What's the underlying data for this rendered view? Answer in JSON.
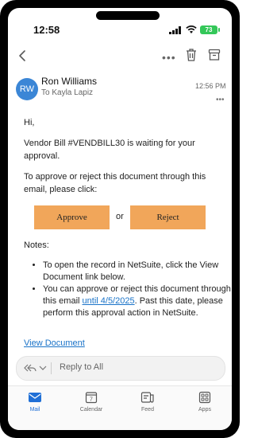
{
  "status_bar": {
    "time": "12:58",
    "battery": "73"
  },
  "message": {
    "avatar_initials": "RW",
    "sender_name": "Ron Williams",
    "recipient": "To Kayla Lapiz",
    "sent_time": "12:56 PM",
    "greeting": "Hi,",
    "paragraph_1": "Vendor Bill #VENDBILL30 is waiting for your approval.",
    "paragraph_2": "To approve or reject this document through this email, please click:",
    "approve_label": "Approve",
    "or_text": "or",
    "reject_label": "Reject",
    "notes_label": "Notes:",
    "note_1": "To open the record in NetSuite, click the View Document link below.",
    "note_2_prefix": "You can approve or reject this document through this email ",
    "note_2_link": "until 4/5/2025",
    "note_2_suffix": ". Past this date, please perform this approval action in NetSuite.",
    "view_document_label": "View Document"
  },
  "reply": {
    "placeholder": "Reply to All"
  },
  "tabs": [
    {
      "label": "Mail",
      "icon": "mail-icon"
    },
    {
      "label": "Calendar",
      "icon": "calendar-icon",
      "calendar_day": "7"
    },
    {
      "label": "Feed",
      "icon": "feed-icon"
    },
    {
      "label": "Apps",
      "icon": "apps-icon"
    }
  ],
  "colors": {
    "accent": "#1f6fd6",
    "button": "#f1a65a",
    "avatar": "#3b86d6",
    "battery": "#34c759"
  }
}
